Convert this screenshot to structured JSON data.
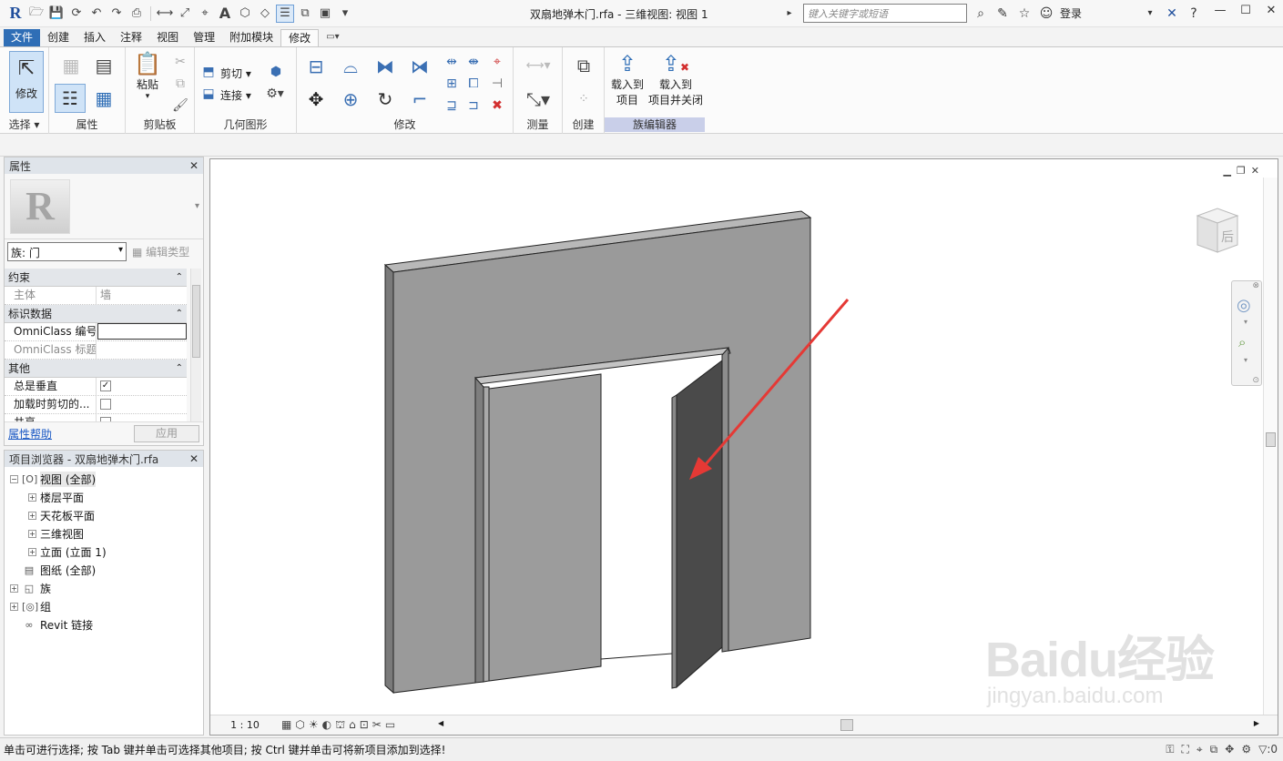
{
  "titlebar": {
    "title": "双扇地弹木门.rfa - 三维视图: 视图 1",
    "search_placeholder": "键入关键字或短语",
    "login": "登录"
  },
  "tabs": [
    "文件",
    "创建",
    "插入",
    "注释",
    "视图",
    "管理",
    "附加模块",
    "修改"
  ],
  "active_tab": "修改",
  "ribbon": {
    "select": {
      "modify": "修改",
      "label": "选择"
    },
    "properties": {
      "label": "属性"
    },
    "clipboard": {
      "paste": "粘贴",
      "label": "剪贴板"
    },
    "geometry": {
      "cut": "剪切",
      "join": "连接",
      "label": "几何图形"
    },
    "modify": {
      "label": "修改"
    },
    "measure": {
      "label": "测量"
    },
    "create": {
      "label": "创建"
    },
    "family_editor": {
      "load_to_project_1": "载入到",
      "load_to_project_2": "项目",
      "load_close_1": "载入到",
      "load_close_2": "项目并关闭",
      "label": "族编辑器"
    }
  },
  "properties": {
    "title": "属性",
    "family_select": "族: 门",
    "edit_type": "编辑类型",
    "sections": [
      {
        "name": "约束",
        "rows": [
          {
            "k": "主体",
            "v": "墙",
            "dim": true
          }
        ]
      },
      {
        "name": "标识数据",
        "rows": [
          {
            "k": "OmniClass 编号",
            "v": "",
            "input": true
          },
          {
            "k": "OmniClass 标题",
            "v": "",
            "dim": true
          }
        ]
      },
      {
        "name": "其他",
        "rows": [
          {
            "k": "总是垂直",
            "v": "✓",
            "checkbox": true
          },
          {
            "k": "加载时剪切的...",
            "v": "",
            "checkbox": true
          },
          {
            "k": "共享",
            "v": "",
            "checkbox": true
          }
        ]
      }
    ],
    "help": "属性帮助",
    "apply": "应用"
  },
  "browser": {
    "title": "项目浏览器 - 双扇地弹木门.rfa",
    "nodes": [
      {
        "label": "视图 (全部)",
        "level": 0,
        "exp": "−",
        "icon": "views-icon",
        "glyph": "[O]"
      },
      {
        "label": "楼层平面",
        "level": 1,
        "exp": "+"
      },
      {
        "label": "天花板平面",
        "level": 1,
        "exp": "+"
      },
      {
        "label": "三维视图",
        "level": 1,
        "exp": "+"
      },
      {
        "label": "立面 (立面 1)",
        "level": 1,
        "exp": "+"
      },
      {
        "label": "图纸 (全部)",
        "level": 0,
        "exp": "",
        "icon": "sheets-icon",
        "glyph": "▤"
      },
      {
        "label": "族",
        "level": 0,
        "exp": "+",
        "icon": "families-icon",
        "glyph": "◱"
      },
      {
        "label": "组",
        "level": 0,
        "exp": "+",
        "icon": "groups-icon",
        "glyph": "[◎]"
      },
      {
        "label": "Revit 链接",
        "level": 0,
        "exp": "",
        "icon": "link-icon",
        "glyph": "∞"
      }
    ]
  },
  "viewport": {
    "viewcube_face": "后",
    "scale": "1 : 10"
  },
  "status": {
    "text": "单击可进行选择; 按 Tab 键并单击可选择其他项目; 按 Ctrl 键并单击可将新项目添加到选择!",
    "filter_count": ":0"
  },
  "watermark": {
    "brand": "Baidu经验",
    "url": "jingyan.baidu.com"
  },
  "colors": {
    "accent": "#2f6eb6",
    "wall": "#9a9a9a",
    "arrow": "#e53935",
    "family_editor_hl": "#c9cfe9"
  }
}
